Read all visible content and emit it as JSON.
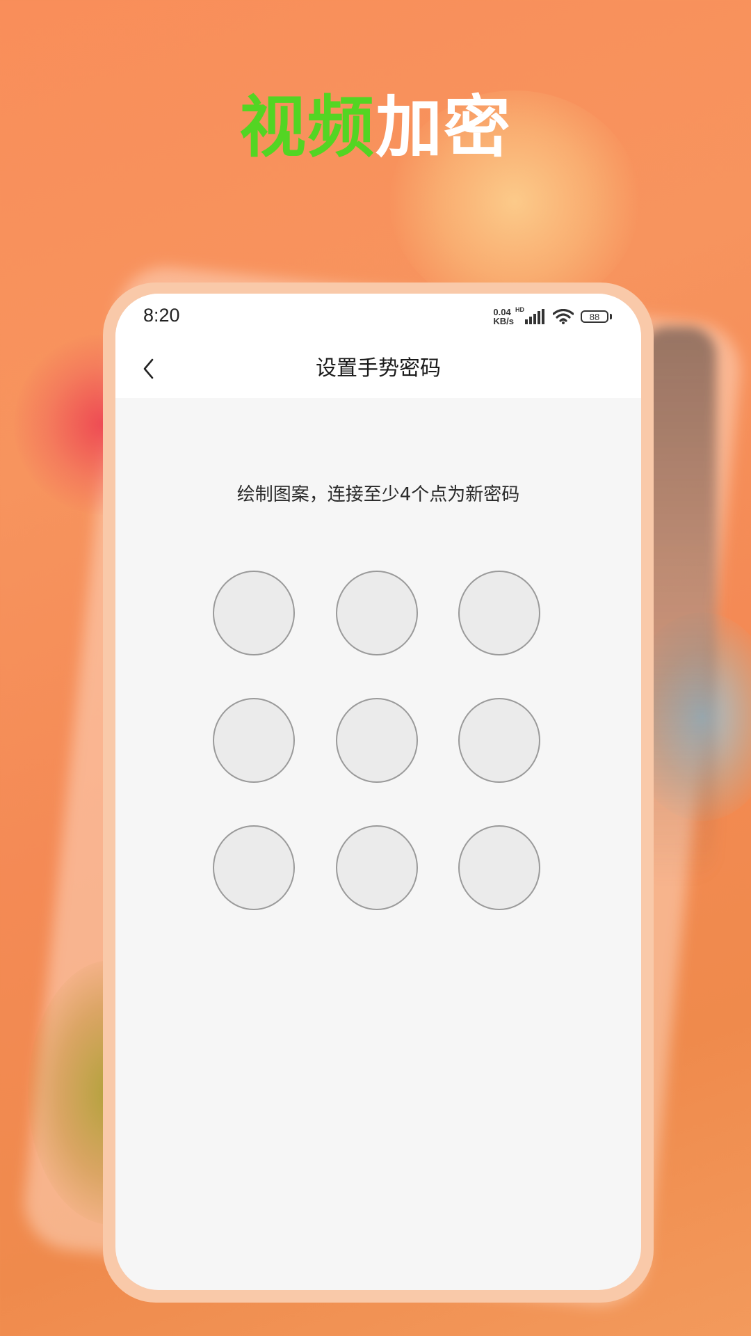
{
  "promo": {
    "headline_green": "视频",
    "headline_white": "加密"
  },
  "status_bar": {
    "time": "8:20",
    "net_speed_value": "0.04",
    "net_speed_unit": "KB/s",
    "hd": "HD",
    "battery": "88"
  },
  "nav": {
    "title": "设置手势密码",
    "back_icon": "chevron-left-icon"
  },
  "content": {
    "instruction": "绘制图案，连接至少4个点为新密码"
  },
  "colors": {
    "headline_green": "#53d523",
    "headline_white": "#ffffff",
    "background": "#f98e5a",
    "screen_background": "#f6f6f6",
    "dot_fill": "#ebebeb",
    "dot_border": "#9a9a9a"
  }
}
